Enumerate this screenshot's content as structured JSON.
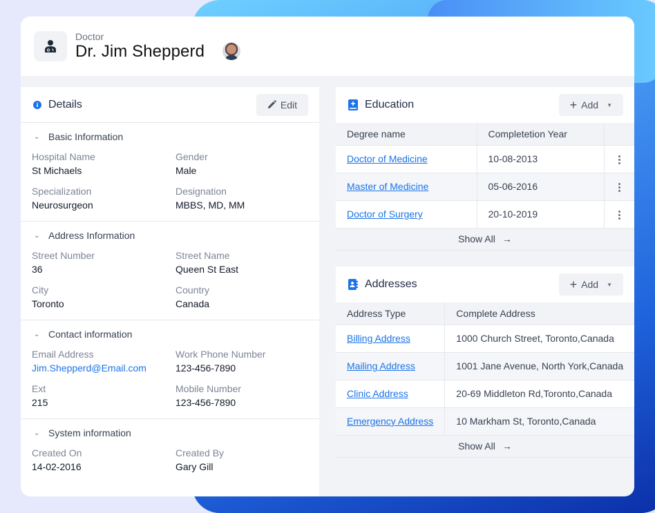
{
  "header": {
    "subtitle": "Doctor",
    "title": "Dr. Jim Shepperd",
    "icon": "doctor-icon",
    "avatar": "user-avatar"
  },
  "details": {
    "title": "Details",
    "icon": "info-icon",
    "edit_label": "Edit",
    "sections": [
      {
        "title": "Basic Information",
        "fields": [
          {
            "label": "Hospital Name",
            "value": "St Michaels"
          },
          {
            "label": "Gender",
            "value": "Male"
          },
          {
            "label": "Specialization",
            "value": "Neurosurgeon"
          },
          {
            "label": "Designation",
            "value": "MBBS, MD, MM"
          }
        ]
      },
      {
        "title": "Address Information",
        "fields": [
          {
            "label": "Street Number",
            "value": "36"
          },
          {
            "label": "Street Name",
            "value": "Queen St East"
          },
          {
            "label": "City",
            "value": "Toronto"
          },
          {
            "label": "Country",
            "value": "Canada"
          }
        ]
      },
      {
        "title": "Contact information",
        "fields": [
          {
            "label": "Email Address",
            "value": "Jim.Shepperd@Email.com"
          },
          {
            "label": "Work Phone Number",
            "value": "123-456-7890"
          },
          {
            "label": "Ext",
            "value": "215"
          },
          {
            "label": "Mobile Number",
            "value": "123-456-7890"
          }
        ]
      },
      {
        "title": "System information",
        "fields": [
          {
            "label": "Created On",
            "value": "14-02-2016"
          },
          {
            "label": "Created By",
            "value": "Gary Gill"
          }
        ]
      }
    ]
  },
  "education": {
    "title": "Education",
    "add_label": "Add",
    "columns": [
      "Degree name",
      "Completetion Year"
    ],
    "rows": [
      {
        "degree": "Doctor of Medicine",
        "year": "10-08-2013"
      },
      {
        "degree": "Master of Medicine",
        "year": "05-06-2016"
      },
      {
        "degree": "Doctor of Surgery",
        "year": "20-10-2019"
      }
    ],
    "show_all": "Show All"
  },
  "addresses": {
    "title": "Addresses",
    "add_label": "Add",
    "columns": [
      "Address Type",
      "Complete Address"
    ],
    "rows": [
      {
        "type": "Billing Address",
        "address": "1000 Church Street, Toronto,Canada"
      },
      {
        "type": "Mailing Address",
        "address": "1001 Jane Avenue, North York,Canada"
      },
      {
        "type": "Clinic Address",
        "address": "20-69 Middleton Rd,Toronto,Canada"
      },
      {
        "type": "Emergency Address",
        "address": "10 Markham St, Toronto,Canada"
      }
    ],
    "show_all": "Show All"
  },
  "colors": {
    "accent": "#1a73e8",
    "background": "#e6e9fb",
    "panel_bg": "#f2f3f7"
  }
}
